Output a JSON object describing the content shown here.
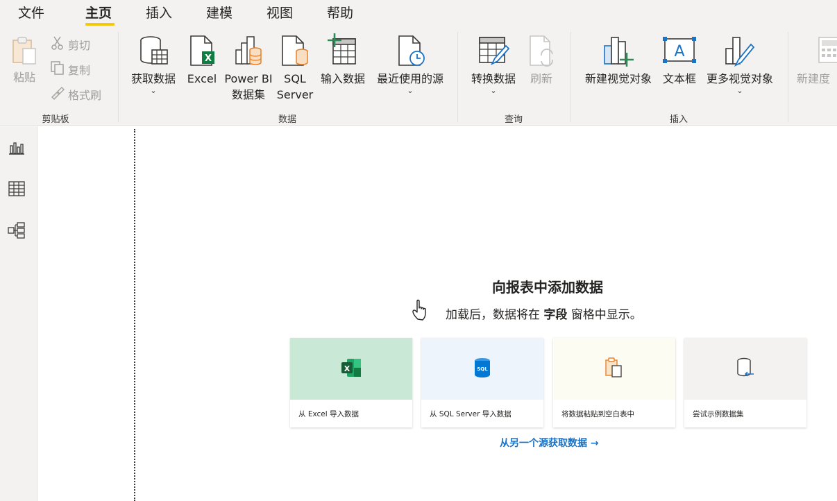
{
  "menu": {
    "tabs": [
      {
        "label": "文件"
      },
      {
        "label": "主页"
      },
      {
        "label": "插入"
      },
      {
        "label": "建模"
      },
      {
        "label": "视图"
      },
      {
        "label": "帮助"
      }
    ],
    "active_tab": "主页",
    "accent_color": "#f2c811"
  },
  "ribbon": {
    "clipboard": {
      "paste": "粘贴",
      "cut": "剪切",
      "copy": "复制",
      "format_painter": "格式刷",
      "group_label": "剪贴板"
    },
    "data": {
      "get_data": "获取数据",
      "excel": "Excel",
      "powerbi_line1": "Power BI",
      "powerbi_line2": "数据集",
      "sql_line1": "SQL",
      "sql_line2": "Server",
      "enter_data": "输入数据",
      "recent_sources": "最近使用的源",
      "group_label": "数据"
    },
    "query": {
      "transform": "转换数据",
      "refresh": "刷新",
      "group_label": "查询"
    },
    "insert": {
      "new_visual": "新建视觉对象",
      "text_box": "文本框",
      "more_visuals": "更多视觉对象",
      "group_label": "插入"
    },
    "calc": {
      "new_measure": "新建度"
    }
  },
  "rail": {
    "icons": [
      "report-view-icon",
      "data-view-icon",
      "model-view-icon"
    ]
  },
  "canvas": {
    "title": "向报表中添加数据",
    "subtitle_before": "加载后，数据将在 ",
    "subtitle_bold": "字段",
    "subtitle_after": " 窗格中显示。",
    "cards": [
      {
        "label": "从 Excel 导入数据",
        "bg": "#c9e9d6"
      },
      {
        "label": "从 SQL Server 导入数据",
        "bg": "#eef4fb"
      },
      {
        "label": "将数据粘贴到空白表中",
        "bg": "#fcfcf3"
      },
      {
        "label": "尝试示例数据集",
        "bg": "#f3f2f1"
      }
    ],
    "other_source_link": "从另一个源获取数据 →"
  }
}
